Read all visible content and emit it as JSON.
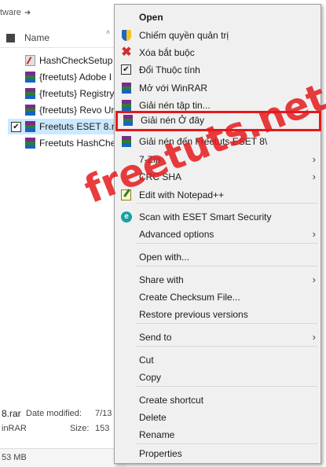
{
  "explorer": {
    "breadcrumb": "tware",
    "header": {
      "name_label": "Name"
    },
    "files": [
      {
        "name": "HashCheckSetup",
        "type": "exe"
      },
      {
        "name": "{freetuts} Adobe I",
        "type": "rar"
      },
      {
        "name": "{freetuts} Registry",
        "type": "rar"
      },
      {
        "name": "{freetuts} Revo Ur",
        "type": "rar"
      },
      {
        "name": "Freetuts ESET 8.ra",
        "type": "rar",
        "selected": true
      },
      {
        "name": "Freetuts HashChe",
        "type": "rar"
      }
    ],
    "details": {
      "name_fragment": "8.rar",
      "type_fragment": "inRAR",
      "date_modified_label": "Date modified:",
      "date_modified_value": "7/13",
      "size_label": "Size:",
      "size_value": "153"
    },
    "status": "53 MB"
  },
  "context_menu": {
    "items": [
      {
        "label": "Open",
        "icon": "none",
        "bold": true
      },
      {
        "label": "Chiếm quyền quản trị",
        "icon": "uac-shield-icon"
      },
      {
        "label": "Xóa bắt buộc",
        "icon": "red-x-icon"
      },
      {
        "label": "Đổi Thuộc tính",
        "icon": "checkbox-icon"
      },
      {
        "label": "Mở với WinRAR",
        "icon": "winrar-icon"
      },
      {
        "label": "Giải nén tập tin...",
        "icon": "winrar-icon"
      },
      {
        "label": "Giải nén Ở đây",
        "icon": "winrar-icon",
        "highlighted": true
      },
      {
        "label": "Giải nén đến Freetuts ESET 8\\",
        "icon": "winrar-icon"
      },
      {
        "label": "7-Zip",
        "icon": "none",
        "submenu": true
      },
      {
        "label": "CRC SHA",
        "icon": "none",
        "submenu": true
      },
      {
        "label": "Edit with Notepad++",
        "icon": "notepad-icon"
      },
      {
        "label": "Scan with ESET Smart Security",
        "icon": "eset-icon"
      },
      {
        "label": "Advanced options",
        "icon": "none",
        "submenu": true
      },
      {
        "label": "Open with...",
        "icon": "none"
      },
      {
        "label": "Share with",
        "icon": "none",
        "submenu": true
      },
      {
        "label": "Create Checksum File...",
        "icon": "none"
      },
      {
        "label": "Restore previous versions",
        "icon": "none"
      },
      {
        "label": "Send to",
        "icon": "none",
        "submenu": true
      },
      {
        "label": "Cut",
        "icon": "none"
      },
      {
        "label": "Copy",
        "icon": "none"
      },
      {
        "label": "Create shortcut",
        "icon": "none"
      },
      {
        "label": "Delete",
        "icon": "none"
      },
      {
        "label": "Rename",
        "icon": "none"
      },
      {
        "label": "Properties",
        "icon": "none"
      }
    ],
    "highlight_color": "#e3191c"
  },
  "watermark": {
    "text": "freetuts.net",
    "color": "#e41a1c"
  }
}
